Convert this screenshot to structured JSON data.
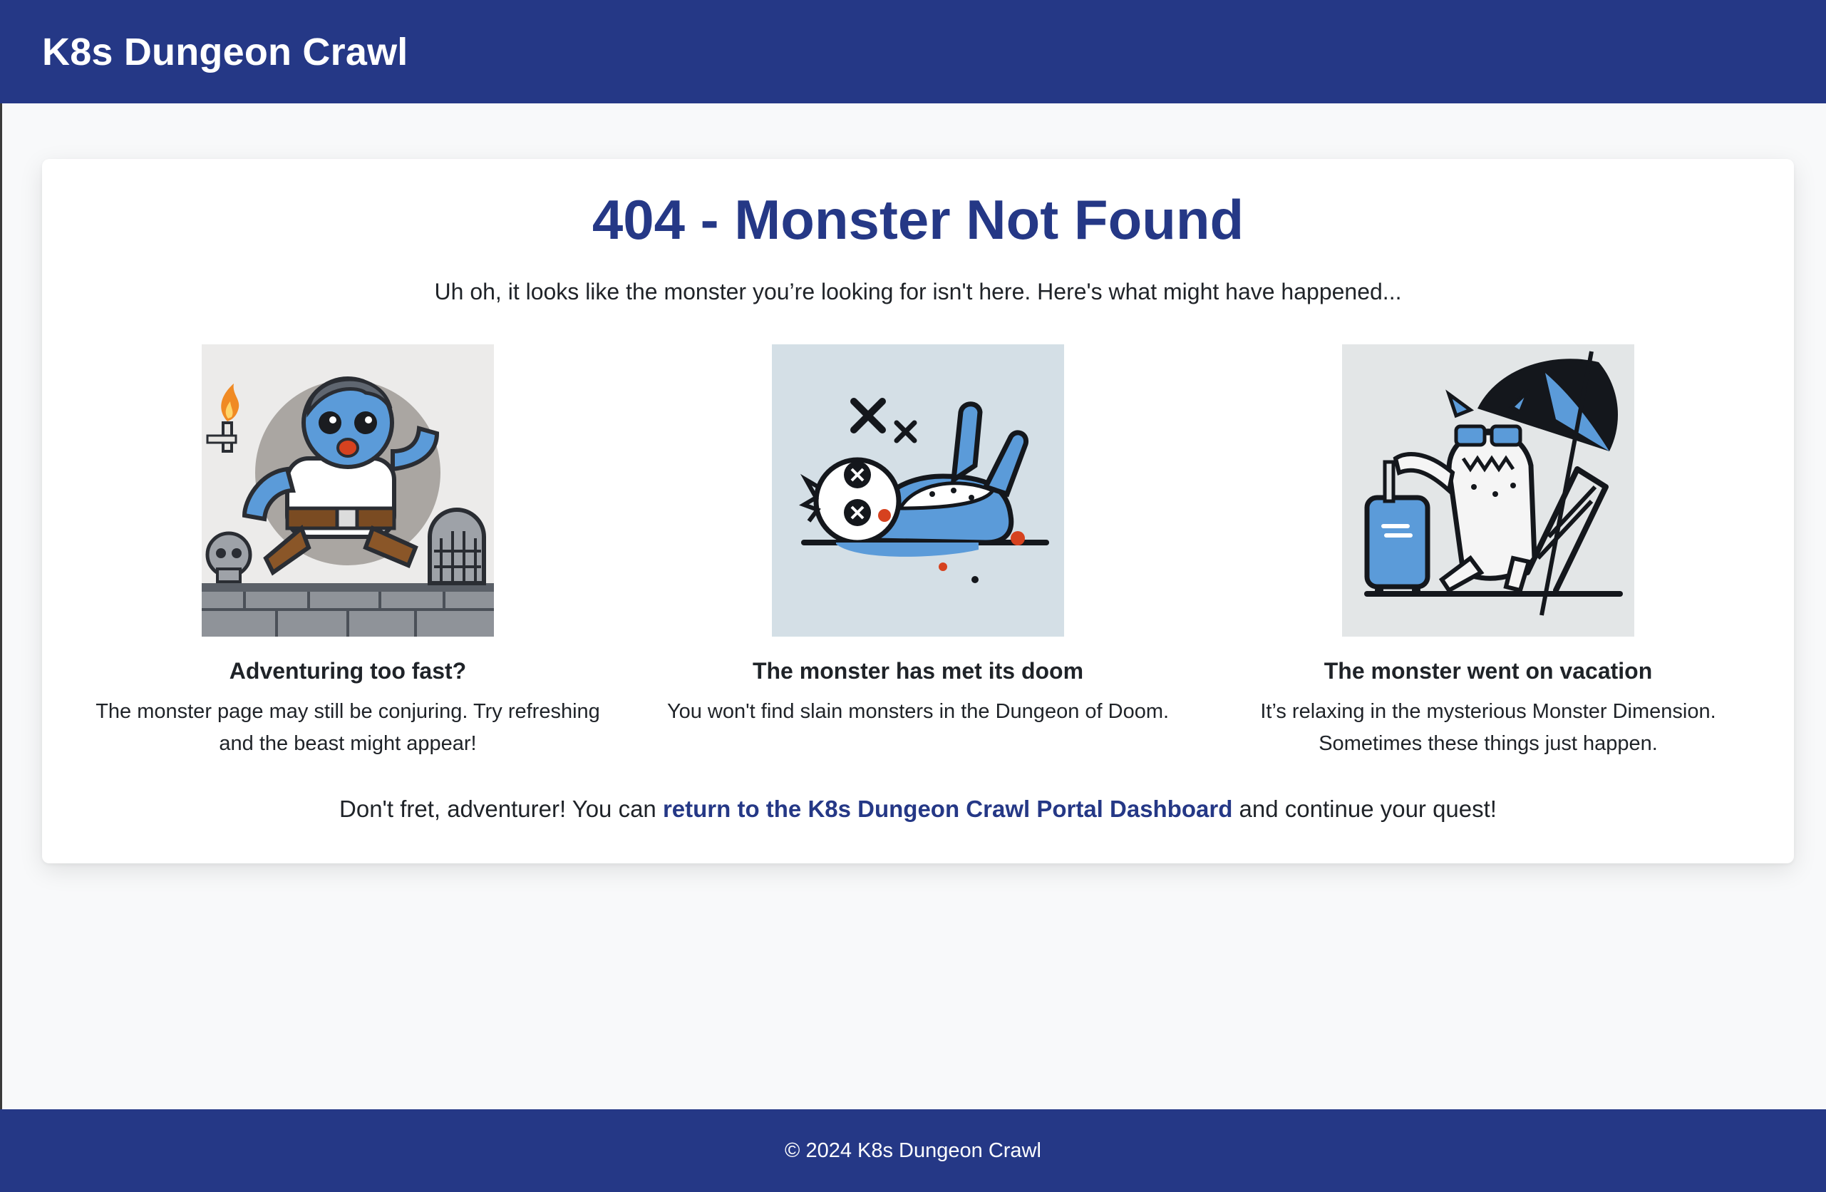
{
  "header": {
    "brand": "K8s Dungeon Crawl"
  },
  "main": {
    "title": "404 - Monster Not Found",
    "subtitle": "Uh oh, it looks like the monster you’re looking for isn't here. Here's what might have happened...",
    "reasons": [
      {
        "title": "Adventuring too fast?",
        "text": "The monster page may still be conjuring. Try refreshing and the beast might appear!",
        "illustration": "running-adventurer-torch-icon"
      },
      {
        "title": "The monster has met its doom",
        "text": "You won't find slain monsters in the Dungeon of Doom.",
        "illustration": "slain-monster-icon"
      },
      {
        "title": "The monster went on vacation",
        "text": "It’s relaxing in the mysterious Monster Dimension. Sometimes these things just happen.",
        "illustration": "vacation-monster-umbrella-icon"
      }
    ],
    "cta": {
      "prefix": "Don't fret, adventurer! You can ",
      "link_text": "return to the K8s Dungeon Crawl Portal Dashboard",
      "suffix": " and continue your quest!"
    }
  },
  "footer": {
    "copyright": "© 2024 K8s Dungeon Crawl"
  },
  "colors": {
    "brand_blue": "#253886",
    "background": "#f8f9fa",
    "card": "#ffffff",
    "monster_blue": "#5b9bd9"
  }
}
